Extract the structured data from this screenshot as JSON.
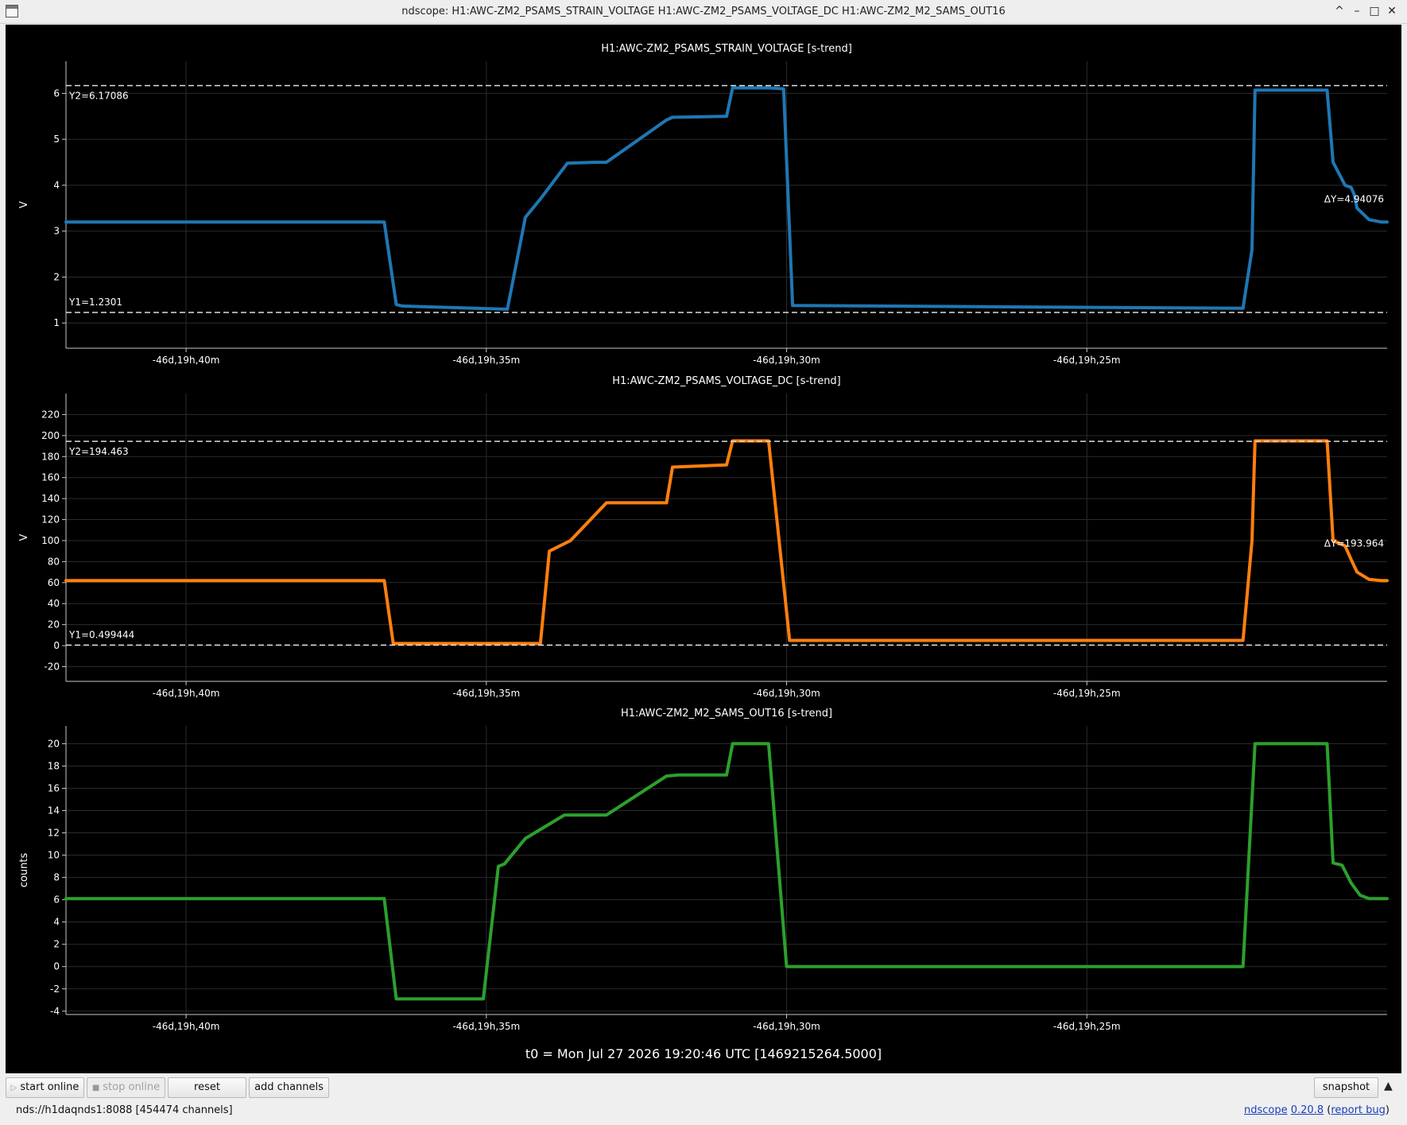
{
  "window": {
    "title": "ndscope: H1:AWC-ZM2_PSAMS_STRAIN_VOLTAGE H1:AWC-ZM2_PSAMS_VOLTAGE_DC H1:AWC-ZM2_M2_SAMS_OUT16",
    "controls": [
      "^",
      "–",
      "□",
      "✕"
    ]
  },
  "colors": {
    "series1": "#1f77b4",
    "series2": "#ff7f0e",
    "series3": "#2ca02c",
    "cursor": "#dddddd",
    "text": "#ffffff"
  },
  "chart_data": [
    {
      "type": "line",
      "title": "H1:AWC-ZM2_PSAMS_STRAIN_VOLTAGE [s-trend]",
      "ylabel": "V",
      "xlabel": "",
      "xlim": [
        -44,
        0
      ],
      "ylim": [
        0.45,
        6.7
      ],
      "grid": true,
      "yticks": [
        1,
        2,
        3,
        4,
        5,
        6
      ],
      "xticks": [
        {
          "value": -40,
          "label": "-46d,19h,40m"
        },
        {
          "value": -30,
          "label": "-46d,19h,35m"
        },
        {
          "value": -20,
          "label": "-46d,19h,30m"
        },
        {
          "value": -10,
          "label": "-46d,19h,25m"
        }
      ],
      "cursors": [
        {
          "axis": "y",
          "value": 6.17086,
          "label": "Y2=6.17086"
        },
        {
          "axis": "y",
          "value": 1.2301,
          "label": "Y1=1.2301"
        }
      ],
      "delta_label": "ΔY=4.94076",
      "series": [
        {
          "color": "#1f77b4",
          "x": [
            -44,
            -33.4,
            -33.0,
            -32.8,
            -29.3,
            -28.7,
            -28.2,
            -27.3,
            -26.4,
            -26.0,
            -24.0,
            -23.8,
            -22.0,
            -21.8,
            -20.6,
            -20.1,
            -19.8,
            -4.8,
            -4.5,
            -4.4,
            -2.0,
            -1.8,
            -1.4,
            -1.2,
            -1.1,
            -1.0,
            -0.6,
            -0.2,
            0
          ],
          "y": [
            3.2,
            3.2,
            1.4,
            1.37,
            1.3,
            3.3,
            3.7,
            4.48,
            4.5,
            4.5,
            5.42,
            5.48,
            5.5,
            6.12,
            6.12,
            6.1,
            1.38,
            1.32,
            2.6,
            6.07,
            6.07,
            4.5,
            4.0,
            3.95,
            3.8,
            3.5,
            3.25,
            3.2,
            3.2
          ]
        }
      ]
    },
    {
      "type": "line",
      "title": "H1:AWC-ZM2_PSAMS_VOLTAGE_DC [s-trend]",
      "ylabel": "V",
      "xlabel": "",
      "xlim": [
        -44,
        0
      ],
      "ylim": [
        -34,
        240
      ],
      "grid": true,
      "yticks": [
        -20,
        0,
        20,
        40,
        60,
        80,
        100,
        120,
        140,
        160,
        180,
        200,
        220
      ],
      "xticks": [
        {
          "value": -40,
          "label": "-46d,19h,40m"
        },
        {
          "value": -30,
          "label": "-46d,19h,35m"
        },
        {
          "value": -20,
          "label": "-46d,19h,30m"
        },
        {
          "value": -10,
          "label": "-46d,19h,25m"
        }
      ],
      "cursors": [
        {
          "axis": "y",
          "value": 194.463,
          "label": "Y2=194.463"
        },
        {
          "axis": "y",
          "value": 0.499444,
          "label": "Y1=0.499444"
        }
      ],
      "delta_label": "ΔY=193.964",
      "series": [
        {
          "color": "#ff7f0e",
          "x": [
            -44,
            -33.4,
            -33.1,
            -28.2,
            -27.9,
            -27.2,
            -26.0,
            -24.0,
            -23.8,
            -22.0,
            -21.8,
            -20.6,
            -19.9,
            -4.8,
            -4.5,
            -4.4,
            -2.0,
            -1.8,
            -1.4,
            -1.2,
            -1.0,
            -0.6,
            -0.2,
            0
          ],
          "y": [
            62,
            62,
            2,
            2,
            90,
            100,
            136,
            136,
            170,
            172,
            195,
            195,
            5,
            5,
            100,
            195,
            195,
            100,
            95,
            82,
            70,
            63,
            62,
            62
          ]
        }
      ]
    },
    {
      "type": "line",
      "title": "H1:AWC-ZM2_M2_SAMS_OUT16 [s-trend]",
      "ylabel": "counts",
      "xlabel": "",
      "xlim": [
        -44,
        0
      ],
      "ylim": [
        -4.3,
        21.6
      ],
      "grid": true,
      "yticks": [
        -4,
        -2,
        0,
        2,
        4,
        6,
        8,
        10,
        12,
        14,
        16,
        18,
        20
      ],
      "xticks": [
        {
          "value": -40,
          "label": "-46d,19h,40m"
        },
        {
          "value": -30,
          "label": "-46d,19h,35m"
        },
        {
          "value": -20,
          "label": "-46d,19h,30m"
        },
        {
          "value": -10,
          "label": "-46d,19h,25m"
        }
      ],
      "cursors": [],
      "delta_label": "",
      "series": [
        {
          "color": "#2ca02c",
          "x": [
            -44,
            -33.4,
            -33.0,
            -30.1,
            -29.6,
            -29.4,
            -28.7,
            -27.4,
            -26.0,
            -24.0,
            -23.6,
            -22.0,
            -21.8,
            -20.6,
            -20.0,
            -4.8,
            -4.5,
            -4.4,
            -2.0,
            -1.8,
            -1.5,
            -1.2,
            -0.9,
            -0.6,
            -0.2,
            0
          ],
          "y": [
            6.1,
            6.1,
            -2.9,
            -2.9,
            9.0,
            9.2,
            11.5,
            13.6,
            13.6,
            17.1,
            17.2,
            17.2,
            20.0,
            20.0,
            0,
            0,
            15.0,
            20.0,
            20.0,
            9.3,
            9.1,
            7.5,
            6.4,
            6.1,
            6.1,
            6.1
          ]
        }
      ]
    }
  ],
  "t0_label": "t0 = Mon Jul 27 2026 19:20:46 UTC [1469215264.5000]",
  "toolbar": {
    "start_online": "start online",
    "stop_online": "stop online",
    "reset": "reset",
    "add_channels": "add channels",
    "snapshot": "snapshot"
  },
  "status": {
    "server": "nds://h1daqnds1:8088  [454474 channels]",
    "app_name": "ndscope",
    "version": "0.20.8",
    "report_bug": "report bug"
  }
}
